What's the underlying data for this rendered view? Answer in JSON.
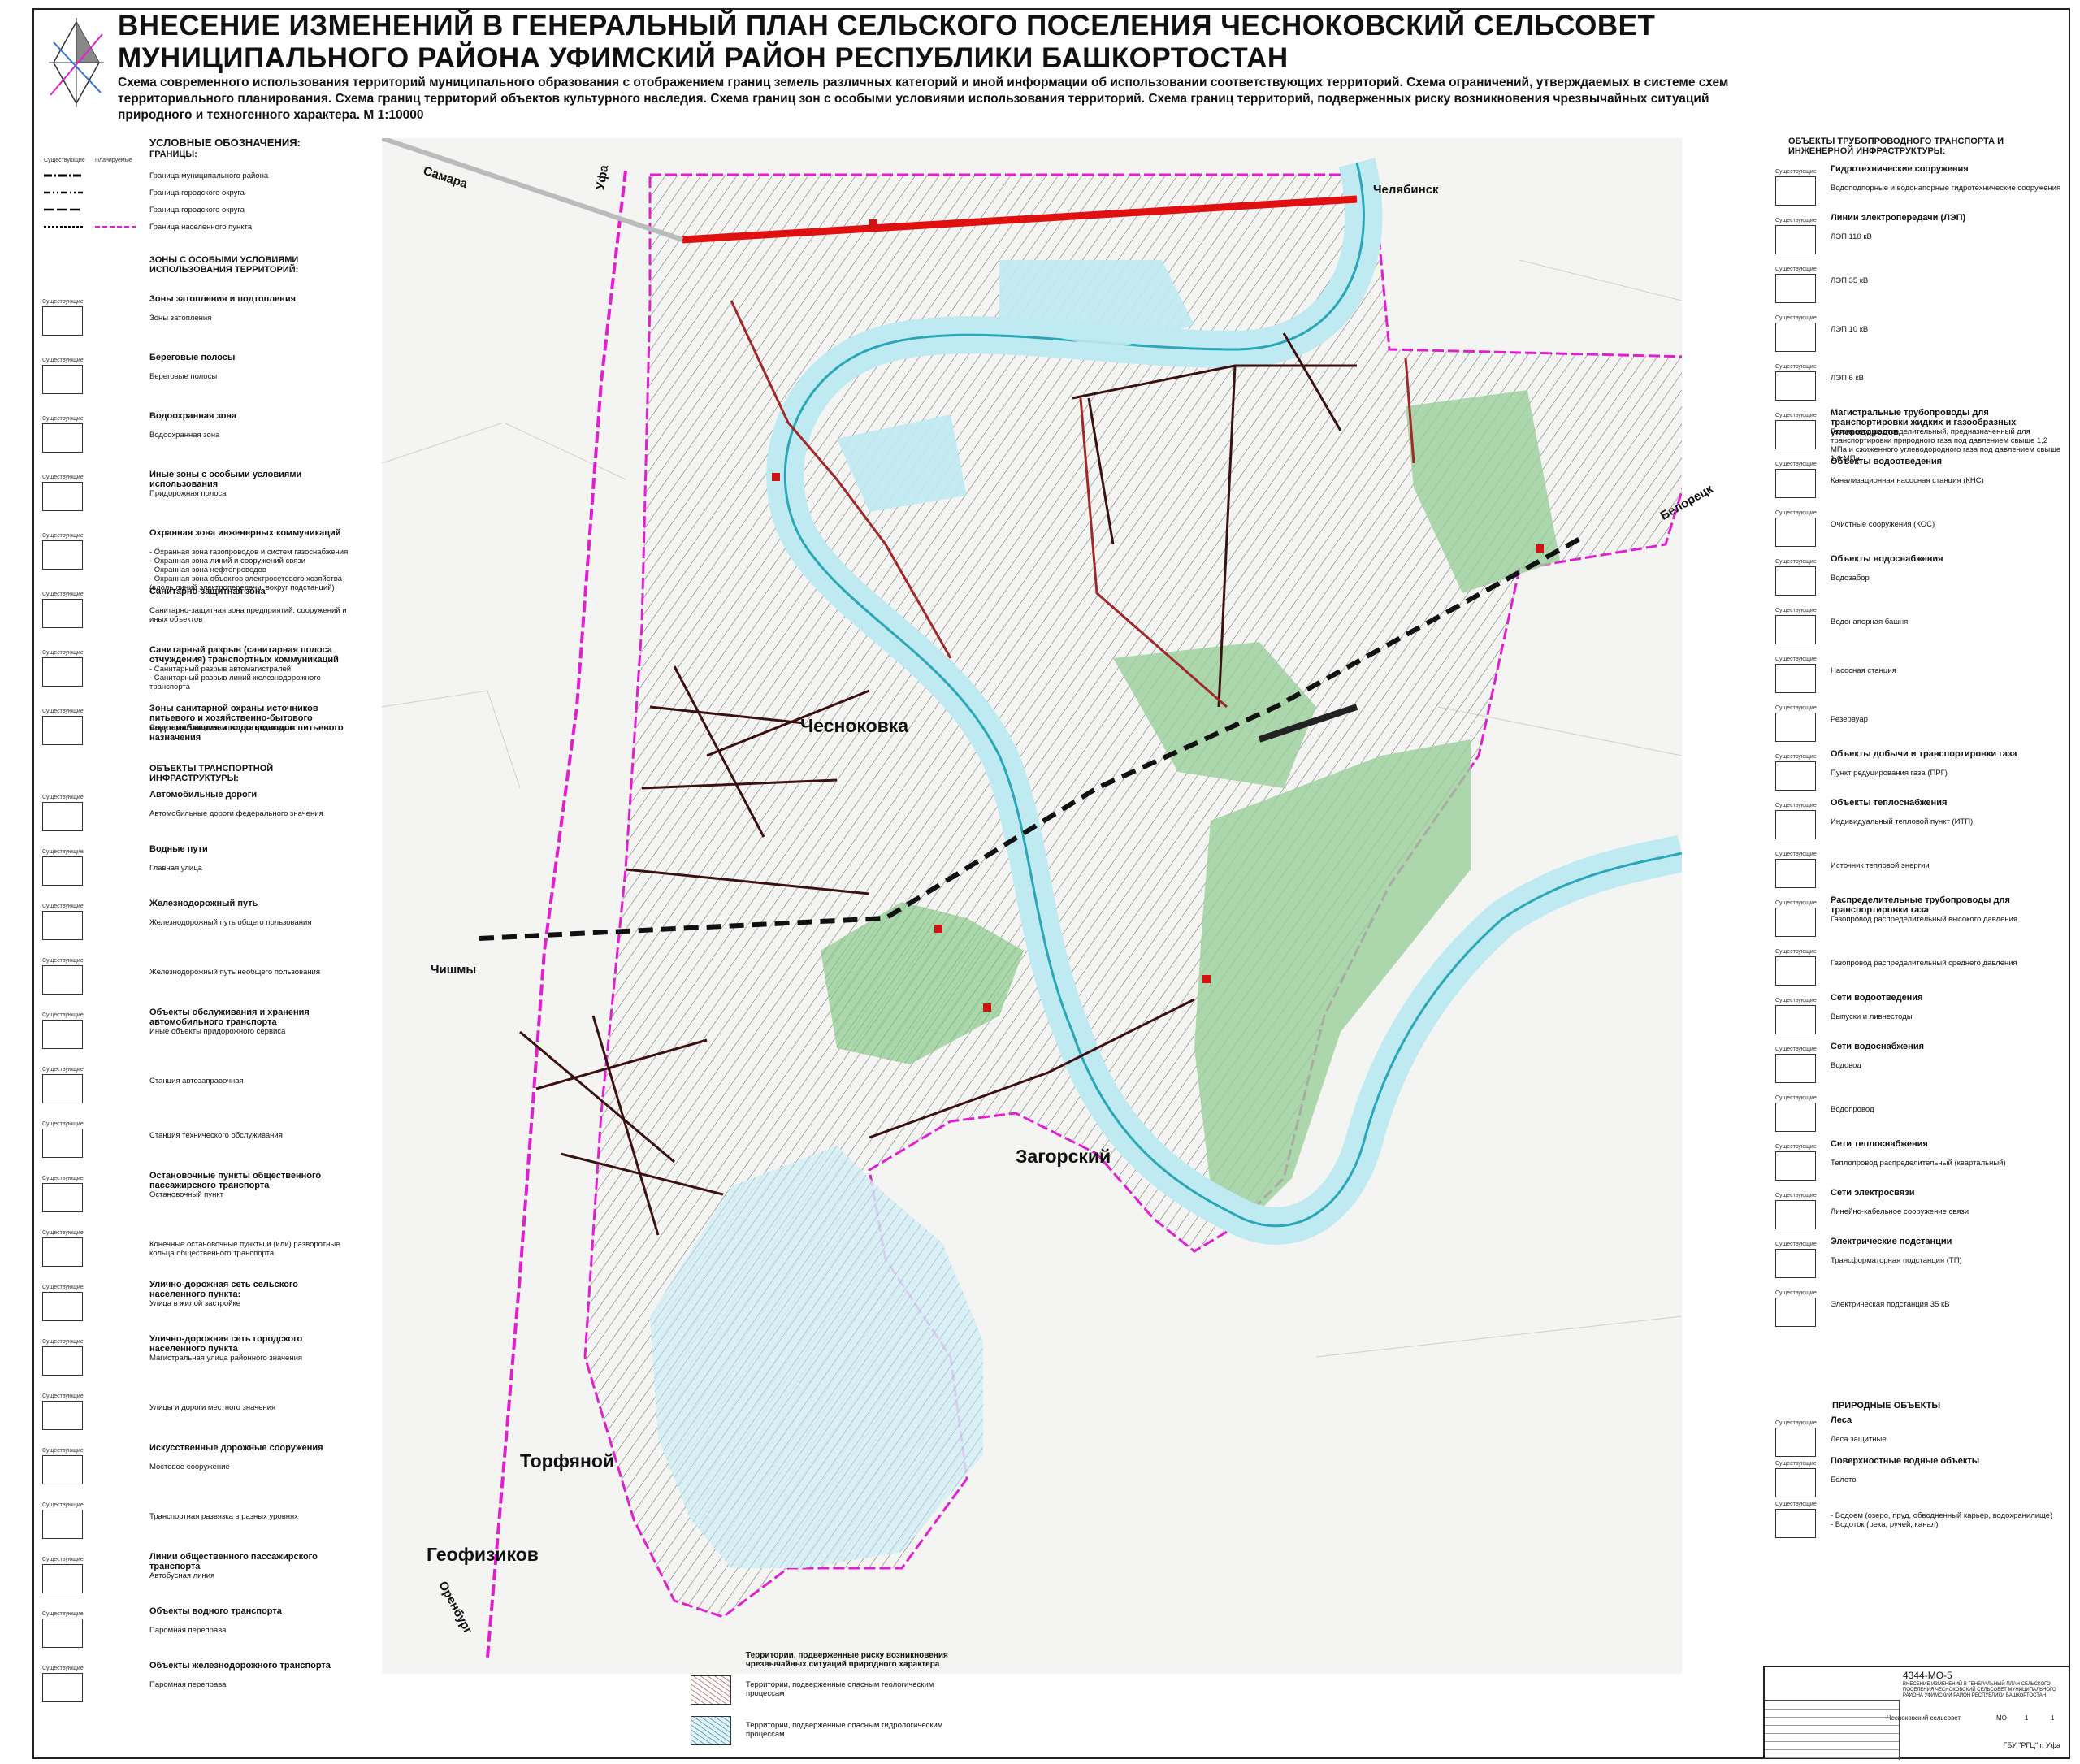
{
  "header": {
    "title_line1": "ВНЕСЕНИЕ ИЗМЕНЕНИЙ В ГЕНЕРАЛЬНЫЙ ПЛАН СЕЛЬСКОГО ПОСЕЛЕНИЯ ЧЕСНОКОВСКИЙ СЕЛЬСОВЕТ",
    "title_line2": "МУНИЦИПАЛЬНОГО РАЙОНА УФИМСКИЙ РАЙОН РЕСПУБЛИКИ БАШКОРТОСТАН",
    "subtitle": "Схема современного использования территорий муниципального образования с отображением границ земель различных категорий и иной информации об использовании соответствующих территорий. Схема ограничений, утверждаемых в системе схем территориального планирования. Схема границ территорий объектов культурного наследия. Схема границ зон с особыми условиями использования территорий. Схема границ территорий, подверженных риску возникновения чрезвычайных ситуаций природного и техногенного характера. М 1:10000"
  },
  "legend_left": {
    "heading": "УСЛОВНЫЕ ОБОЗНАЧЕНИЯ:",
    "boundaries_heading": "ГРАНИЦЫ:",
    "col_existing": "Существующие",
    "col_planned": "Планируемые",
    "boundaries": [
      "Граница муниципального района",
      "Граница городского округа",
      "Граница городского округа",
      "Граница населенного пункта"
    ],
    "zones_heading": "ЗОНЫ С ОСОБЫМИ УСЛОВИЯМИ ИСПОЛЬЗОВАНИЯ ТЕРРИТОРИЙ:",
    "zones": [
      {
        "title": "Зоны затопления и подтопления",
        "label": "Зоны затопления"
      },
      {
        "title": "Береговые полосы",
        "label": "Береговые полосы"
      },
      {
        "title": "Водоохранная зона",
        "label": "Водоохранная зона"
      },
      {
        "title": "Иные зоны с особыми условиями использования",
        "label": "Придорожная полоса"
      },
      {
        "title": "Охранная зона инженерных коммуникаций",
        "label": "- Охранная зона газопроводов и систем газоснабжения\n- Охранная зона линий и сооружений связи\n- Охранная зона нефтепроводов\n- Охранная зона объектов электросетевого хозяйства (вдоль линий электропередачи, вокруг подстанций)"
      },
      {
        "title": "Санитарно-защитная зона",
        "label": "Санитарно-защитная зона предприятий, сооружений и иных объектов"
      },
      {
        "title": "Санитарный разрыв (санитарная полоса отчуждения) транспортных коммуникаций",
        "label": "- Санитарный разрыв автомагистралей\n- Санитарный разрыв линий железнодорожного транспорта"
      },
      {
        "title": "Зоны санитарной охраны источников питьевого и хозяйственно-бытового водоснабжения и водопроводов питьевого назначения",
        "label": "Санитарно-защитная полоса водоводов"
      }
    ],
    "transport_heading": "ОБЪЕКТЫ ТРАНСПОРТНОЙ ИНФРАСТРУКТУРЫ:",
    "transport": [
      {
        "title": "Автомобильные дороги",
        "label": "Автомобильные дороги федерального значения"
      },
      {
        "title": "Водные пути",
        "label": "Главная улица"
      },
      {
        "title": "Железнодорожный путь",
        "label": "Железнодорожный путь общего пользования"
      },
      {
        "title": "",
        "label": "Железнодорожный путь необщего пользования"
      },
      {
        "title": "Объекты обслуживания и хранения автомобильного транспорта",
        "label": "Иные объекты придорожного сервиса"
      },
      {
        "title": "",
        "label": "Станция автозаправочная"
      },
      {
        "title": "",
        "label": "Станция технического обслуживания"
      },
      {
        "title": "Остановочные пункты общественного пассажирского транспорта",
        "label": "Остановочный пункт"
      },
      {
        "title": "",
        "label": "Конечные остановочные пункты и (или) разворотные кольца общественного транспорта"
      },
      {
        "title": "Улично-дорожная сеть сельского населенного пункта:",
        "label": "Улица в жилой застройке"
      },
      {
        "title": "Улично-дорожная сеть городского населенного пункта",
        "label": "Магистральная улица районного значения"
      },
      {
        "title": "",
        "label": "Улицы и дороги местного значения"
      },
      {
        "title": "Искусственные дорожные сооружения",
        "label": "Мостовое сооружение"
      },
      {
        "title": "",
        "label": "Транспортная развязка в разных уровнях"
      },
      {
        "title": "Линии общественного пассажирского транспорта",
        "label": "Автобусная линия"
      },
      {
        "title": "Объекты водного транспорта",
        "label": "Паромная переправа"
      },
      {
        "title": "Объекты железнодорожного транспорта",
        "label": "Паромная переправа"
      }
    ]
  },
  "legend_right": {
    "heading": "ОБЪЕКТЫ ТРУБОПРОВОДНОГО ТРАНСПОРТА И ИНЖЕНЕРНОЙ ИНФРАСТРУКТУРЫ:",
    "col_existing": "Существующие",
    "items": [
      {
        "title": "Гидротехнические сооружения",
        "label": "Водоподпорные и водонапорные гидротехнические сооружения"
      },
      {
        "title": "Линии электропередачи (ЛЭП)",
        "label": "ЛЭП 110 кВ"
      },
      {
        "title": "",
        "label": "ЛЭП 35 кВ"
      },
      {
        "title": "",
        "label": "ЛЭП 10 кВ"
      },
      {
        "title": "",
        "label": "ЛЭП 6 кВ"
      },
      {
        "title": "Магистральные трубопроводы для транспортировки жидких и газообразных углеводородов",
        "label": "Газопровод распределительный, предназначенный для транспортировки природного газа под давлением свыше 1,2 МПа и сжиженного углеводородного газа под давлением свыше 1,6 МПа"
      },
      {
        "title": "Объекты водоотведения",
        "label": "Канализационная насосная станция (КНС)"
      },
      {
        "title": "",
        "label": "Очистные сооружения (КОС)"
      },
      {
        "title": "Объекты водоснабжения",
        "label": "Водозабор"
      },
      {
        "title": "",
        "label": "Водонапорная башня"
      },
      {
        "title": "",
        "label": "Насосная станция"
      },
      {
        "title": "",
        "label": "Резервуар"
      },
      {
        "title": "Объекты добычи и транспортировки газа",
        "label": "Пункт редуцирования газа (ПРГ)"
      },
      {
        "title": "Объекты теплоснабжения",
        "label": "Индивидуальный тепловой пункт (ИТП)"
      },
      {
        "title": "",
        "label": "Источник тепловой энергии"
      },
      {
        "title": "Распределительные трубопроводы для транспортировки газа",
        "label": "Газопровод распределительный высокого давления"
      },
      {
        "title": "",
        "label": "Газопровод распределительный среднего давления"
      },
      {
        "title": "Сети водоотведения",
        "label": "Выпуски и ливнестоды"
      },
      {
        "title": "Сети водоснабжения",
        "label": "Водовод"
      },
      {
        "title": "",
        "label": "Водопровод"
      },
      {
        "title": "Сети теплоснабжения",
        "label": "Теплопровод распределительный (квартальный)"
      },
      {
        "title": "Сети электросвязи",
        "label": "Линейно-кабельное сооружение связи"
      },
      {
        "title": "Электрические подстанции",
        "label": "Трансформаторная подстанция (ТП)"
      },
      {
        "title": "",
        "label": "Электрическая подстанция 35 кВ"
      }
    ],
    "nature_heading": "ПРИРОДНЫЕ ОБЪЕКТЫ",
    "nature": [
      {
        "title": "Леса",
        "label": "Леса защитные"
      },
      {
        "title": "Поверхностные водные объекты",
        "label": "Болото"
      },
      {
        "title": "",
        "label": "- Водоем (озеро, пруд, обводненный карьер, водохранилище)\n- Водоток (река, ручей, канал)"
      }
    ]
  },
  "legend_bottom": {
    "heading": "Территории, подверженные риску возникновения чрезвычайных ситуаций природного характера",
    "items": [
      "Территории, подверженные опасным геологическим процессам",
      "Территории, подверженные опасным гидрологическим процессам"
    ]
  },
  "map": {
    "places": [
      "Чесноковка",
      "Загорский",
      "Торфяной",
      "Геофизиков"
    ],
    "directions": [
      "Самара",
      "Уфа",
      "Челябинск",
      "Белорецк",
      "Чишмы",
      "Оренбург"
    ],
    "colors": {
      "river": "#bfeaf1",
      "forest": "#8fcf8f",
      "boundary": "#e020d0",
      "federal_road": "#e01010",
      "land": "#f5f5f3"
    }
  },
  "stamp": {
    "code": "4344-МО-5",
    "description": "ВНЕСЕНИЕ ИЗМЕНЕНИЙ В ГЕНЕРАЛЬНЫЙ ПЛАН СЕЛЬСКОГО ПОСЕЛЕНИЯ ЧЕСНОКОВСКИЙ СЕЛЬСОВЕТ МУНИЦИПАЛЬНОГО РАЙОНА УФИМСКИЙ РАЙОН РЕСПУБЛИКИ БАШКОРТОСТАН",
    "sheet_name": "Чесноковский сельсовет",
    "stage": "МО",
    "sheet": "1",
    "sheets": "1",
    "org": "ГБУ \"РГЦ\" г. Уфа"
  }
}
